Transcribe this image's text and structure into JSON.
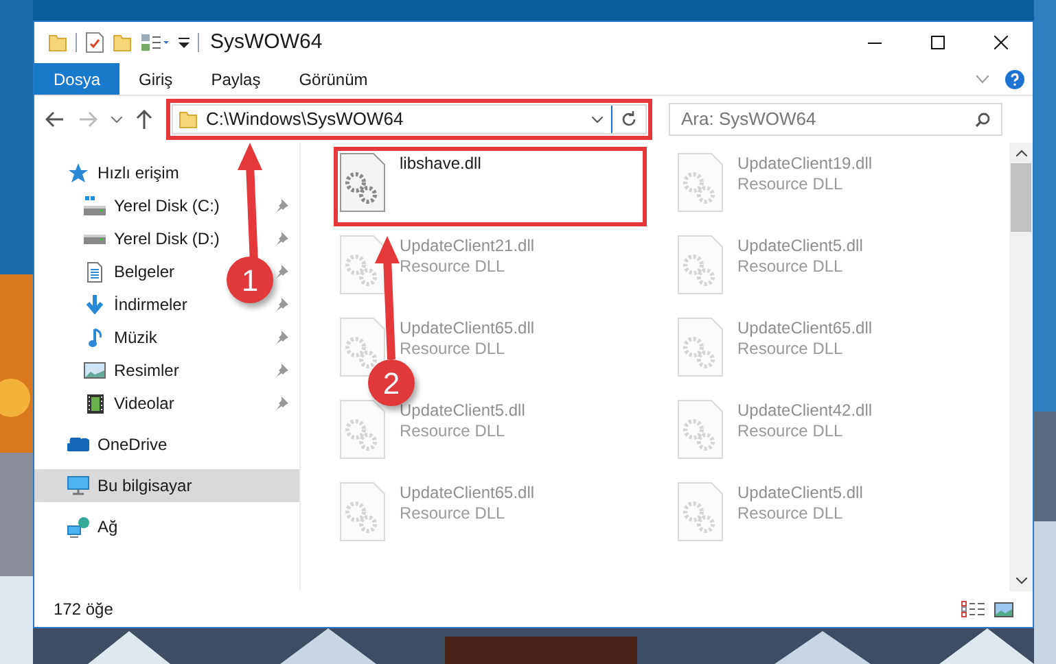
{
  "window": {
    "title": "SysWOW64"
  },
  "ribbon": {
    "tabs": [
      {
        "label": "Dosya",
        "selected": true
      },
      {
        "label": "Giriş",
        "selected": false
      },
      {
        "label": "Paylaş",
        "selected": false
      },
      {
        "label": "Görünüm",
        "selected": false
      }
    ]
  },
  "address_bar": {
    "path": "C:\\Windows\\SysWOW64"
  },
  "search": {
    "placeholder": "Ara: SysWOW64"
  },
  "sidebar": {
    "items": [
      {
        "label": "Hızlı erişim",
        "selected": false,
        "children": [
          {
            "label": "Yerel Disk (C:)",
            "pinned": true,
            "selected": false
          },
          {
            "label": "Yerel Disk (D:)",
            "pinned": true,
            "selected": false
          },
          {
            "label": "Belgeler",
            "pinned": true,
            "selected": false
          },
          {
            "label": "İndirmeler",
            "pinned": true,
            "selected": false
          },
          {
            "label": "Müzik",
            "pinned": true,
            "selected": false
          },
          {
            "label": "Resimler",
            "pinned": true,
            "selected": false
          },
          {
            "label": "Videolar",
            "pinned": true,
            "selected": false
          }
        ]
      },
      {
        "label": "OneDrive",
        "selected": false
      },
      {
        "label": "Bu bilgisayar",
        "selected": true
      },
      {
        "label": "Ağ",
        "selected": false
      }
    ]
  },
  "files": [
    {
      "name": "libshave.dll",
      "dimmed": false,
      "highlighted": true
    },
    {
      "name": "UpdateClient19.dll",
      "type": "Resource DLL",
      "dimmed": true,
      "highlighted": false
    },
    {
      "name": "UpdateClient21.dll",
      "type": "Resource DLL",
      "dimmed": true,
      "highlighted": false
    },
    {
      "name": "UpdateClient5.dll",
      "type": "Resource DLL",
      "dimmed": true,
      "highlighted": false
    },
    {
      "name": "UpdateClient65.dll",
      "type": "Resource DLL",
      "dimmed": true,
      "highlighted": false
    },
    {
      "name": "UpdateClient65.dll",
      "type": "Resource DLL",
      "dimmed": true,
      "highlighted": false
    },
    {
      "name": "UpdateClient5.dll",
      "type": "Resource DLL",
      "dimmed": true,
      "highlighted": false
    },
    {
      "name": "UpdateClient42.dll",
      "type": "Resource DLL",
      "dimmed": true,
      "highlighted": false
    },
    {
      "name": "UpdateClient65.dll",
      "type": "Resource DLL",
      "dimmed": true,
      "highlighted": false
    },
    {
      "name": "UpdateClient5.dll",
      "type": "Resource DLL",
      "dimmed": true,
      "highlighted": false
    }
  ],
  "annotations": [
    {
      "number": "1"
    },
    {
      "number": "2"
    }
  ],
  "status_bar": {
    "count": "172 öğe"
  }
}
